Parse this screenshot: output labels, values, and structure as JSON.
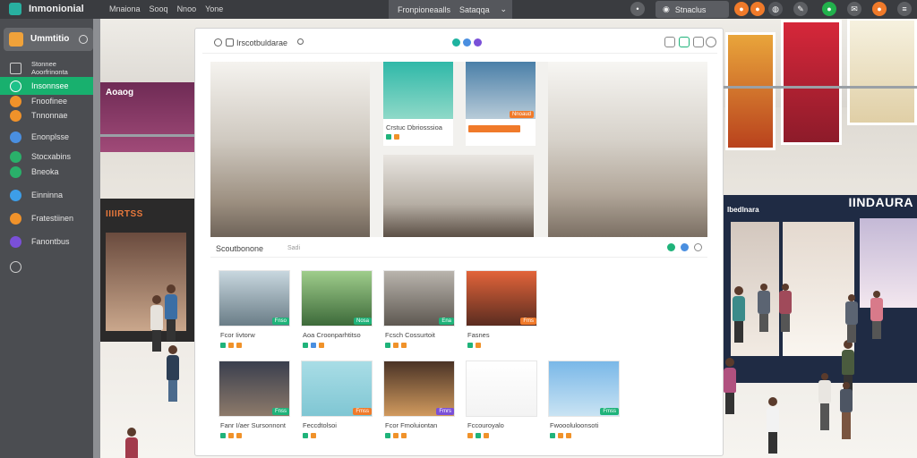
{
  "app": {
    "title": "Inmonionial"
  },
  "menu": [
    "Mnaiona",
    "Sooq",
    "Nnoo",
    "Yone"
  ],
  "center_tab": {
    "label1": "Fronpioneaalls",
    "label2": "Sataqqa"
  },
  "status": {
    "label": "Stnaclus"
  },
  "sidebar": {
    "header": "Ummtitio",
    "items": [
      {
        "label": "Stonnee\nAoorfrinonta",
        "icon": "layout-icon",
        "color": "#cfcfcf"
      },
      {
        "label": "Insonnsee",
        "icon": "teal-icon",
        "color": "#1ec28a"
      },
      {
        "label": "Fnoofinee",
        "icon": "orange-icon",
        "color": "#f0922a"
      },
      {
        "label": "Tnnonnae",
        "icon": "orange-icon",
        "color": "#f0922a"
      },
      {
        "label": "Enonplsse",
        "icon": "blue-icon",
        "color": "#4a8fe0"
      },
      {
        "label": "Stocxabins",
        "icon": "green-icon",
        "color": "#2ab06a"
      },
      {
        "label": "Bneoka",
        "icon": "green-icon",
        "color": "#2ab06a"
      },
      {
        "label": "Einninna",
        "icon": "blue-icon",
        "color": "#3d9ee8"
      },
      {
        "label": "Fratestiinen",
        "icon": "orange-icon",
        "color": "#f0922a"
      },
      {
        "label": "Fanontbus",
        "icon": "purple-icon",
        "color": "#7a50d8"
      },
      {
        "label": "",
        "icon": "settings-icon",
        "color": "#bbbbbb"
      }
    ]
  },
  "panel": {
    "title": "Irscotbuldarae",
    "hero_tiles": [
      {
        "caption": "Crstuc Dbriosssioa",
        "tag": "",
        "tag_color": "#1fb37a"
      },
      {
        "caption": "",
        "tag": "Nnoaud",
        "tag_color": "#f07a2a"
      }
    ],
    "section_title": "Scoutbonone",
    "section_sub": "Sadi",
    "cards": [
      {
        "caption": "Fcor Iivtorw",
        "tag": "Fnso",
        "tag_color": "#1fb37a",
        "bg": "linear-gradient(180deg,#c8d7df,#6a7d87)"
      },
      {
        "caption": "Aoa Croonparhtitso",
        "tag": "Nosa",
        "tag_color": "#1fb37a",
        "bg": "linear-gradient(180deg,#9fcd8b,#3d6a3a)"
      },
      {
        "caption": "Fcsch Cossurtoit",
        "tag": "Ena",
        "tag_color": "#1fb37a",
        "bg": "linear-gradient(180deg,#b9b4ad,#5e5851)"
      },
      {
        "caption": "Fasnes",
        "tag": "Fms",
        "tag_color": "#f07a2a",
        "bg": "linear-gradient(180deg,#e2643a,#5a2c20)"
      },
      {
        "caption": "Fanr I/aer Sursonnont",
        "tag": "Fnss",
        "tag_color": "#1fb37a",
        "bg": "linear-gradient(180deg,#3a3f4e,#8d7a6a)"
      },
      {
        "caption": "Feccdtolsoi",
        "tag": "Fmss",
        "tag_color": "#f07a2a",
        "bg": "linear-gradient(180deg,#a9dde6,#7fc6d3)"
      },
      {
        "caption": "Fcor Fmoluiontan",
        "tag": "Fmrs",
        "tag_color": "#7a50d8",
        "bg": "linear-gradient(180deg,#4a3326,#d19a5e)"
      },
      {
        "caption": "Fccouroyalo",
        "tag": "",
        "tag_color": "#1fb37a",
        "bg": "linear-gradient(180deg,#ffffff,#f3f3f3)"
      },
      {
        "caption": "Fwoooluloonsoti",
        "tag": "Fmss",
        "tag_color": "#1fb37a",
        "bg": "linear-gradient(180deg,#7ab8e8,#c9e3f3)"
      }
    ]
  },
  "background": {
    "store_left": "IIIIRTSS",
    "balcony_left": "Aoaog",
    "store_right": "IINDAURA",
    "store_right_small": "Ibedlnara"
  },
  "colors": {
    "accent": "#18b06e",
    "topbar": "#3a3c40",
    "sidebar": "#4b4d51"
  }
}
